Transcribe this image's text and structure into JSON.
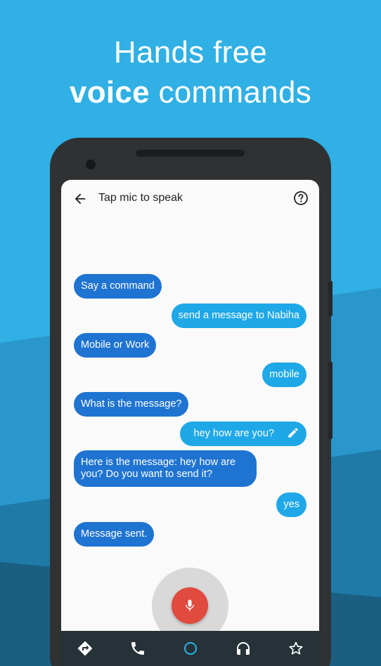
{
  "headline": {
    "line1": "Hands free",
    "line2_bold": "voice",
    "line2_rest": "commands"
  },
  "colors": {
    "background": "#30b0e4",
    "assistant_bubble": "#1f74d2",
    "user_bubble": "#1ea8e8",
    "mic_button": "#e04a3f",
    "nav_bar": "#263238",
    "nav_active": "#28b6e8"
  },
  "topbar": {
    "back_icon": "arrow-back-icon",
    "title": "Tap mic to speak",
    "help_icon": "help-circle-icon"
  },
  "conversation": [
    {
      "from": "assistant",
      "text": "Say a command"
    },
    {
      "from": "user",
      "text": "send a message to Nabiha"
    },
    {
      "from": "assistant",
      "text": "Mobile or Work"
    },
    {
      "from": "user",
      "text": "mobile"
    },
    {
      "from": "assistant",
      "text": "What is the message?"
    },
    {
      "from": "user",
      "text": "hey how are you?",
      "icon": "edit-icon"
    },
    {
      "from": "assistant",
      "text": "Here is the message: hey how are you?  Do you want to send it?"
    },
    {
      "from": "user",
      "text": "yes"
    },
    {
      "from": "assistant",
      "text": "Message sent."
    }
  ],
  "mic": {
    "icon": "microphone-icon"
  },
  "navbar": {
    "items": [
      {
        "icon": "directions-icon"
      },
      {
        "icon": "phone-icon"
      },
      {
        "icon": "assistant-circle-icon",
        "active": true
      },
      {
        "icon": "headphones-icon"
      },
      {
        "icon": "star-icon"
      }
    ]
  }
}
